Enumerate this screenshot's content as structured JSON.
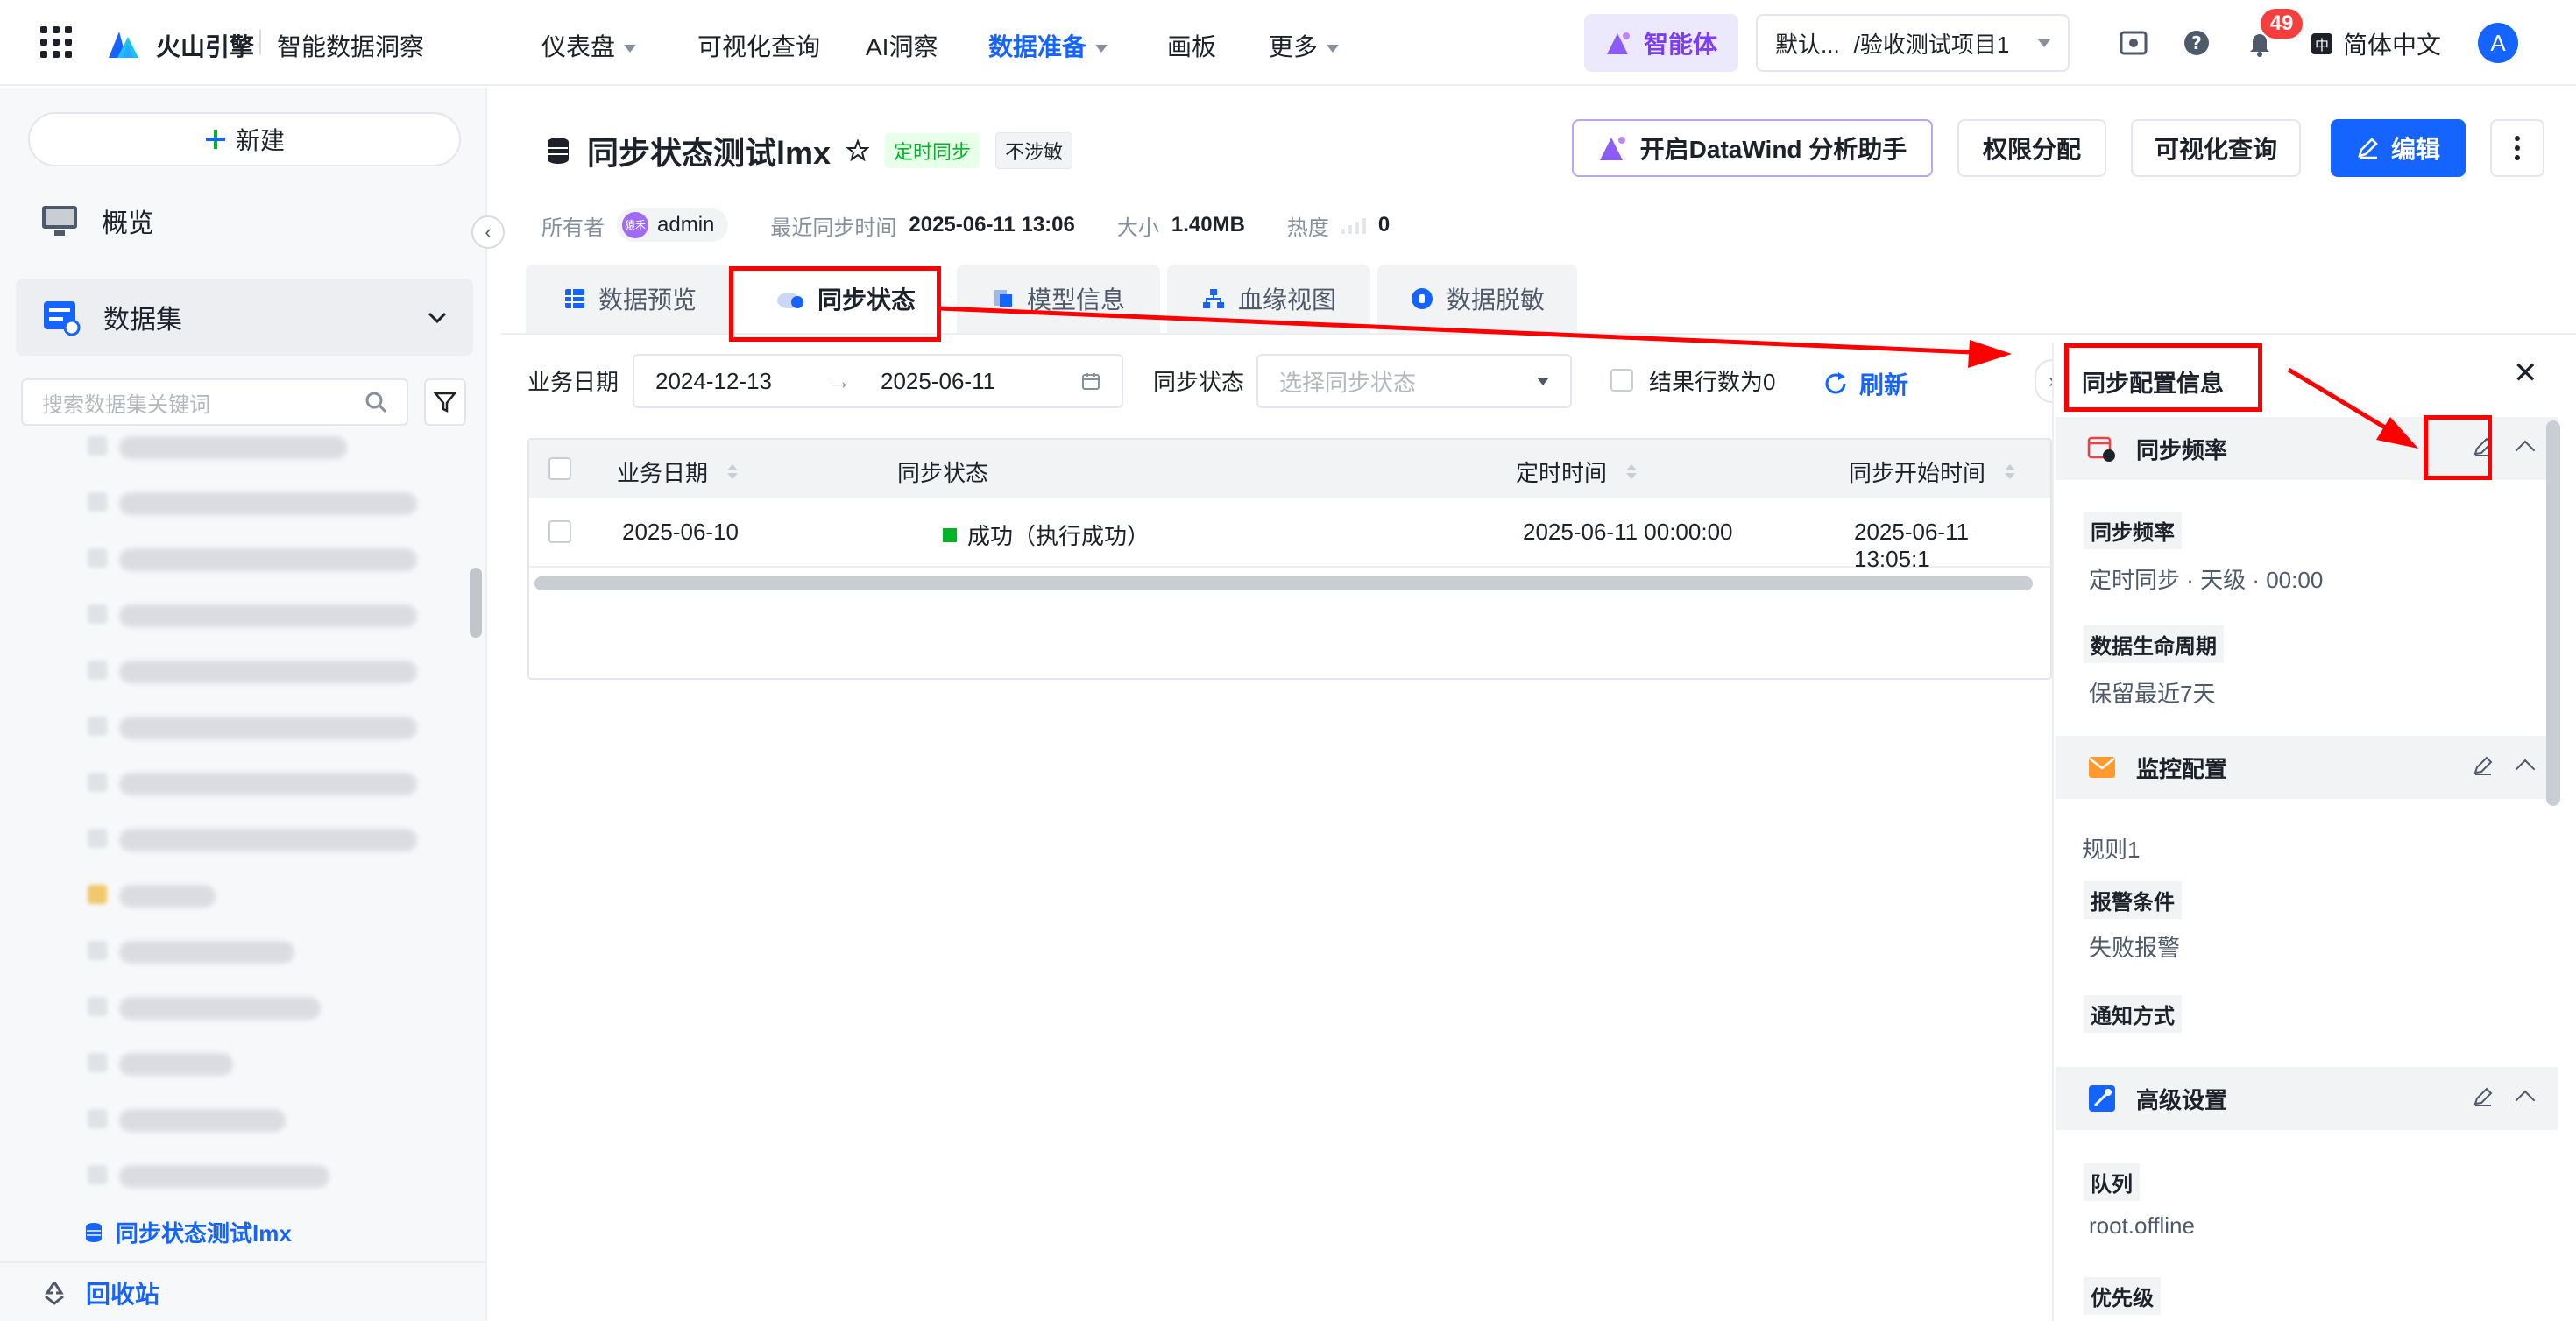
{
  "brand": {
    "name": "火山引擎",
    "product": "智能数据洞察"
  },
  "nav": [
    {
      "label": "仪表盘"
    },
    {
      "label": "可视化查询"
    },
    {
      "label": "AI洞察"
    },
    {
      "label": "数据准备"
    },
    {
      "label": "画板"
    },
    {
      "label": "更多"
    }
  ],
  "topbar": {
    "agent_label": "智能体",
    "project_default": "默认...",
    "project_path": "/验收测试项目1",
    "notification_count": "49",
    "language": "简体中文",
    "avatar_letter": "A"
  },
  "sidebar": {
    "new_label": "新建",
    "overview_label": "概览",
    "dataset_label": "数据集",
    "search_placeholder": "搜索数据集关键词",
    "active_item": "同步状态测试lmx",
    "recycle_label": "回收站"
  },
  "dataset": {
    "name": "同步状态测试lmx",
    "tag_sync": "定时同步",
    "tag_sensitive": "不涉敏",
    "owner_label": "所有者",
    "owner_avatar": "猿禾",
    "owner": "admin",
    "last_sync_label": "最近同步时间",
    "last_sync": "2025-06-11 13:06",
    "size_label": "大小",
    "size": "1.40MB",
    "heat_label": "热度",
    "heat": "0"
  },
  "actions": {
    "datawind": "开启DataWind 分析助手",
    "permissions": "权限分配",
    "visual_query": "可视化查询",
    "edit": "编辑"
  },
  "tabs": [
    {
      "label": "数据预览"
    },
    {
      "label": "同步状态"
    },
    {
      "label": "模型信息"
    },
    {
      "label": "血缘视图"
    },
    {
      "label": "数据脱敏"
    }
  ],
  "filters": {
    "biz_date_label": "业务日期",
    "date_start": "2024-12-13",
    "date_end": "2025-06-11",
    "sync_status_label": "同步状态",
    "sync_status_placeholder": "选择同步状态",
    "zero_rows_label": "结果行数为0",
    "refresh_label": "刷新"
  },
  "table": {
    "columns": [
      "业务日期",
      "同步状态",
      "定时时间",
      "同步开始时间"
    ],
    "rows": [
      {
        "biz_date": "2025-06-10",
        "status": "成功（执行成功）",
        "scheduled": "2025-06-11 00:00:00",
        "start": "2025-06-11 13:05:1"
      }
    ]
  },
  "panel": {
    "title": "同步配置信息",
    "sections": [
      {
        "title": "同步频率",
        "fields": [
          {
            "label": "同步频率",
            "value": "定时同步 · 天级 · 00:00"
          },
          {
            "label": "数据生命周期",
            "value": "保留最近7天"
          }
        ]
      },
      {
        "title": "监控配置",
        "rule": "规则1",
        "fields": [
          {
            "label": "报警条件",
            "value": "失败报警"
          },
          {
            "label": "通知方式",
            "value": ""
          }
        ]
      },
      {
        "title": "高级设置",
        "fields": [
          {
            "label": "队列",
            "value": "root.offline"
          },
          {
            "label": "优先级",
            "value": ""
          }
        ]
      }
    ]
  },
  "colors": {
    "accent": "#1664ff",
    "success": "#00b42a",
    "annotation": "#ff0000",
    "agent": "#7b3ff2"
  }
}
